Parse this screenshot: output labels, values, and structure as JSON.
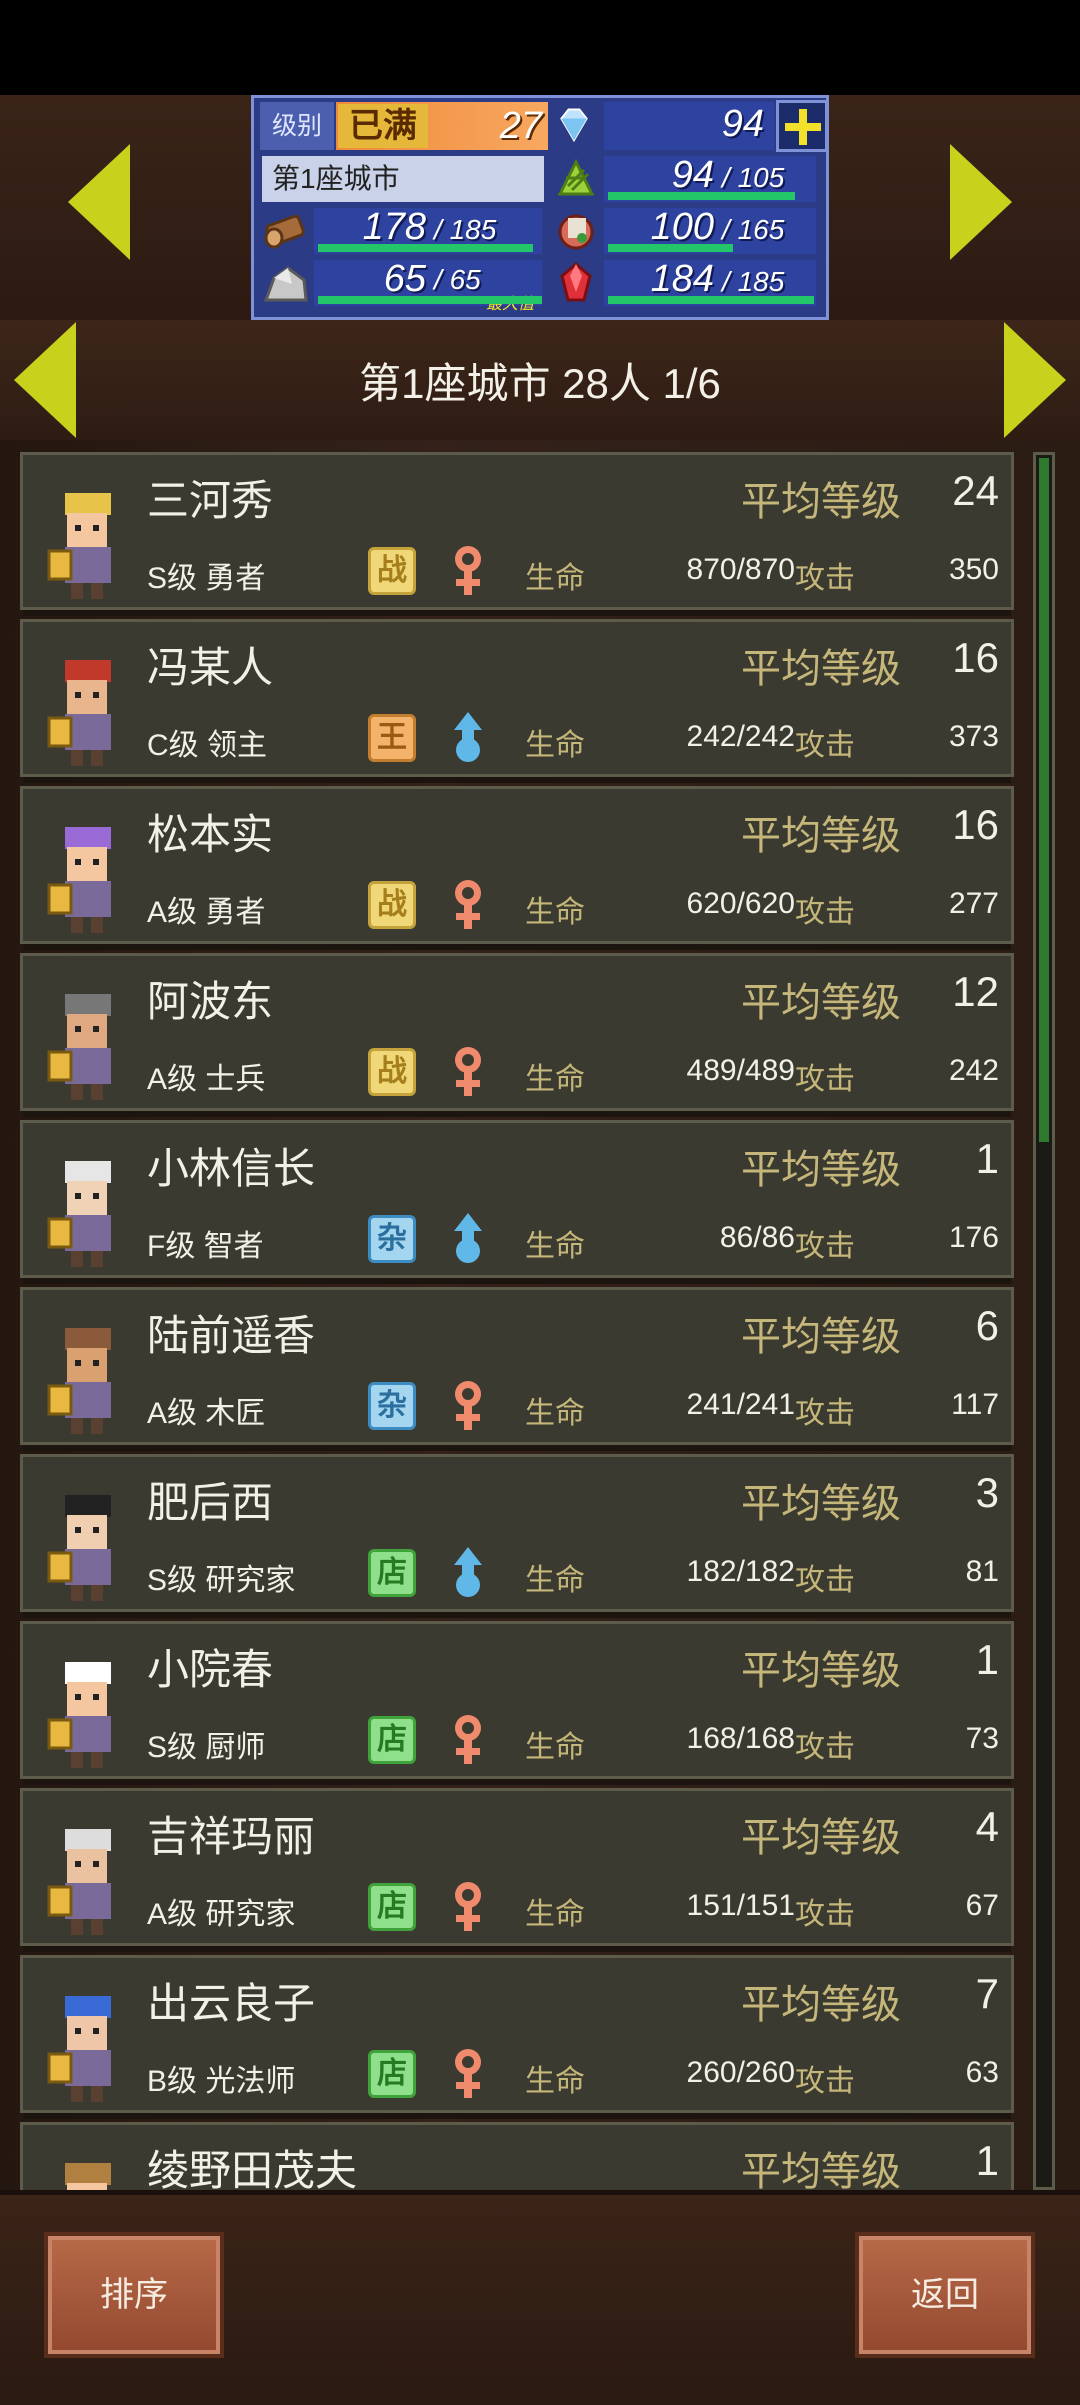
{
  "header": {
    "level_label": "级别",
    "level_tag": "已满",
    "level_value": "27",
    "gems": "94",
    "city_name": "第1座城市",
    "food": {
      "value": "94",
      "max": "105",
      "fill": 0.9
    },
    "wood": {
      "value": "178",
      "max": "185",
      "fill": 0.96
    },
    "meat": {
      "value": "100",
      "max": "165",
      "fill": 0.6
    },
    "stone": {
      "value": "65",
      "max": "65",
      "max_tag": "最大值",
      "fill": 1.0
    },
    "ruby": {
      "value": "184",
      "max": "185",
      "fill": 0.99
    }
  },
  "title": "第1座城市  28人 1/6",
  "labels": {
    "avg_level": "平均等级",
    "hp": "生命",
    "attack": "攻击"
  },
  "members": [
    {
      "name": "三河秀",
      "rank": "S级 勇者",
      "job_icon": "战",
      "job_type": "zhan",
      "gender": "female",
      "avg_level": "24",
      "hp": "870/870",
      "attack": "350"
    },
    {
      "name": "冯某人",
      "rank": "C级 领主",
      "job_icon": "王",
      "job_type": "wang",
      "gender": "male",
      "avg_level": "16",
      "hp": "242/242",
      "attack": "373"
    },
    {
      "name": "松本实",
      "rank": "A级 勇者",
      "job_icon": "战",
      "job_type": "zhan",
      "gender": "female",
      "avg_level": "16",
      "hp": "620/620",
      "attack": "277"
    },
    {
      "name": "阿波东",
      "rank": "A级 士兵",
      "job_icon": "战",
      "job_type": "zhan",
      "gender": "female",
      "avg_level": "12",
      "hp": "489/489",
      "attack": "242"
    },
    {
      "name": "小林信长",
      "rank": "F级 智者",
      "job_icon": "杂",
      "job_type": "za",
      "gender": "male",
      "avg_level": "1",
      "hp": "86/86",
      "attack": "176"
    },
    {
      "name": "陆前遥香",
      "rank": "A级 木匠",
      "job_icon": "杂",
      "job_type": "za",
      "gender": "female",
      "avg_level": "6",
      "hp": "241/241",
      "attack": "117"
    },
    {
      "name": "肥后西",
      "rank": "S级 研究家",
      "job_icon": "店",
      "job_type": "dian",
      "gender": "male",
      "avg_level": "3",
      "hp": "182/182",
      "attack": "81"
    },
    {
      "name": "小院春",
      "rank": "S级 厨师",
      "job_icon": "店",
      "job_type": "dian",
      "gender": "female",
      "avg_level": "1",
      "hp": "168/168",
      "attack": "73"
    },
    {
      "name": "吉祥玛丽",
      "rank": "A级 研究家",
      "job_icon": "店",
      "job_type": "dian",
      "gender": "female",
      "avg_level": "4",
      "hp": "151/151",
      "attack": "67"
    },
    {
      "name": "出云良子",
      "rank": "B级 光法师",
      "job_icon": "店",
      "job_type": "dian",
      "gender": "female",
      "avg_level": "7",
      "hp": "260/260",
      "attack": "63"
    },
    {
      "name": "绫野田茂夫",
      "rank": "",
      "job_icon": "",
      "job_type": "",
      "gender": "",
      "avg_level": "1",
      "hp": "",
      "attack": ""
    }
  ],
  "buttons": {
    "sort": "排序",
    "back": "返回"
  },
  "colors": {
    "female": "#f08a6c",
    "male": "#5fb8e8",
    "arrow": "#c8d21c",
    "gold_text": "#c5b67a"
  }
}
